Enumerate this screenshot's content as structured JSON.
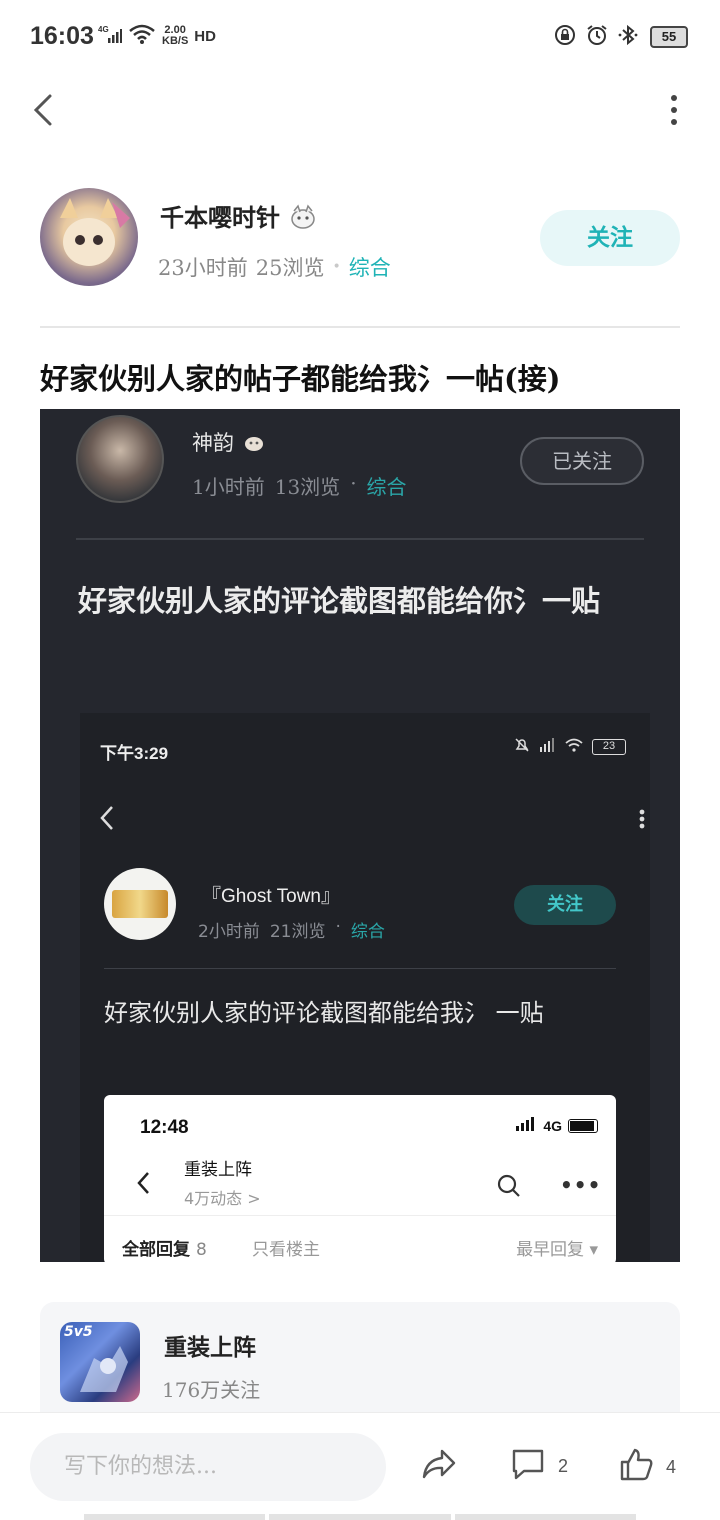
{
  "status_bar": {
    "time": "16:03",
    "network": "4G",
    "speed_value": "2.00",
    "speed_unit": "KB/S",
    "hd": "HD",
    "battery": "55",
    "icons": [
      "signal-icon",
      "wifi-icon",
      "lock-rotation-icon",
      "alarm-icon",
      "bluetooth-icon",
      "battery-icon"
    ]
  },
  "nav": {
    "back_icon": "back-arrow-icon",
    "more_icon": "more-vertical-icon"
  },
  "author": {
    "name": "千本嘤时针",
    "time_ago": "23小时前",
    "views": "25浏览",
    "dot": "•",
    "tag": "综合",
    "follow_label": "关注"
  },
  "post": {
    "title": "好家伙别人家的帖子都能给我氵一帖(接)"
  },
  "embedded_post": {
    "author_name": "神韵",
    "time_ago": "1小时前",
    "views": "13浏览",
    "dot": "·",
    "tag": "综合",
    "follow_label": "已关注",
    "title": "好家伙别人家的评论截图都能给你氵一贴"
  },
  "nested_screenshot": {
    "time": "下午3:29",
    "battery": "23",
    "author_name": "『Ghost Town』",
    "time_ago": "2小时前",
    "views": "21浏览",
    "dot": "·",
    "tag": "综合",
    "follow_label": "关注",
    "title": "好家伙别人家的评论截图都能给我氵 一贴"
  },
  "inner_card": {
    "time": "12:48",
    "network": "4G",
    "forum_name": "重装上阵",
    "forum_sub": "4万动态 >",
    "all_replies_label": "全部回复",
    "all_replies_count": "8",
    "owner_only_label": "只看楼主",
    "sort_label": "最早回复 ▾"
  },
  "forum": {
    "icon_text": "5v5",
    "name": "重装上阵",
    "followers": "176万关注"
  },
  "bottom_bar": {
    "placeholder": "写下你的想法...",
    "comment_count": "2",
    "like_count": "4"
  },
  "colors": {
    "accent": "#1fb3b6",
    "follow_bg": "#e7f7f8",
    "dark_bg": "#25272e"
  }
}
